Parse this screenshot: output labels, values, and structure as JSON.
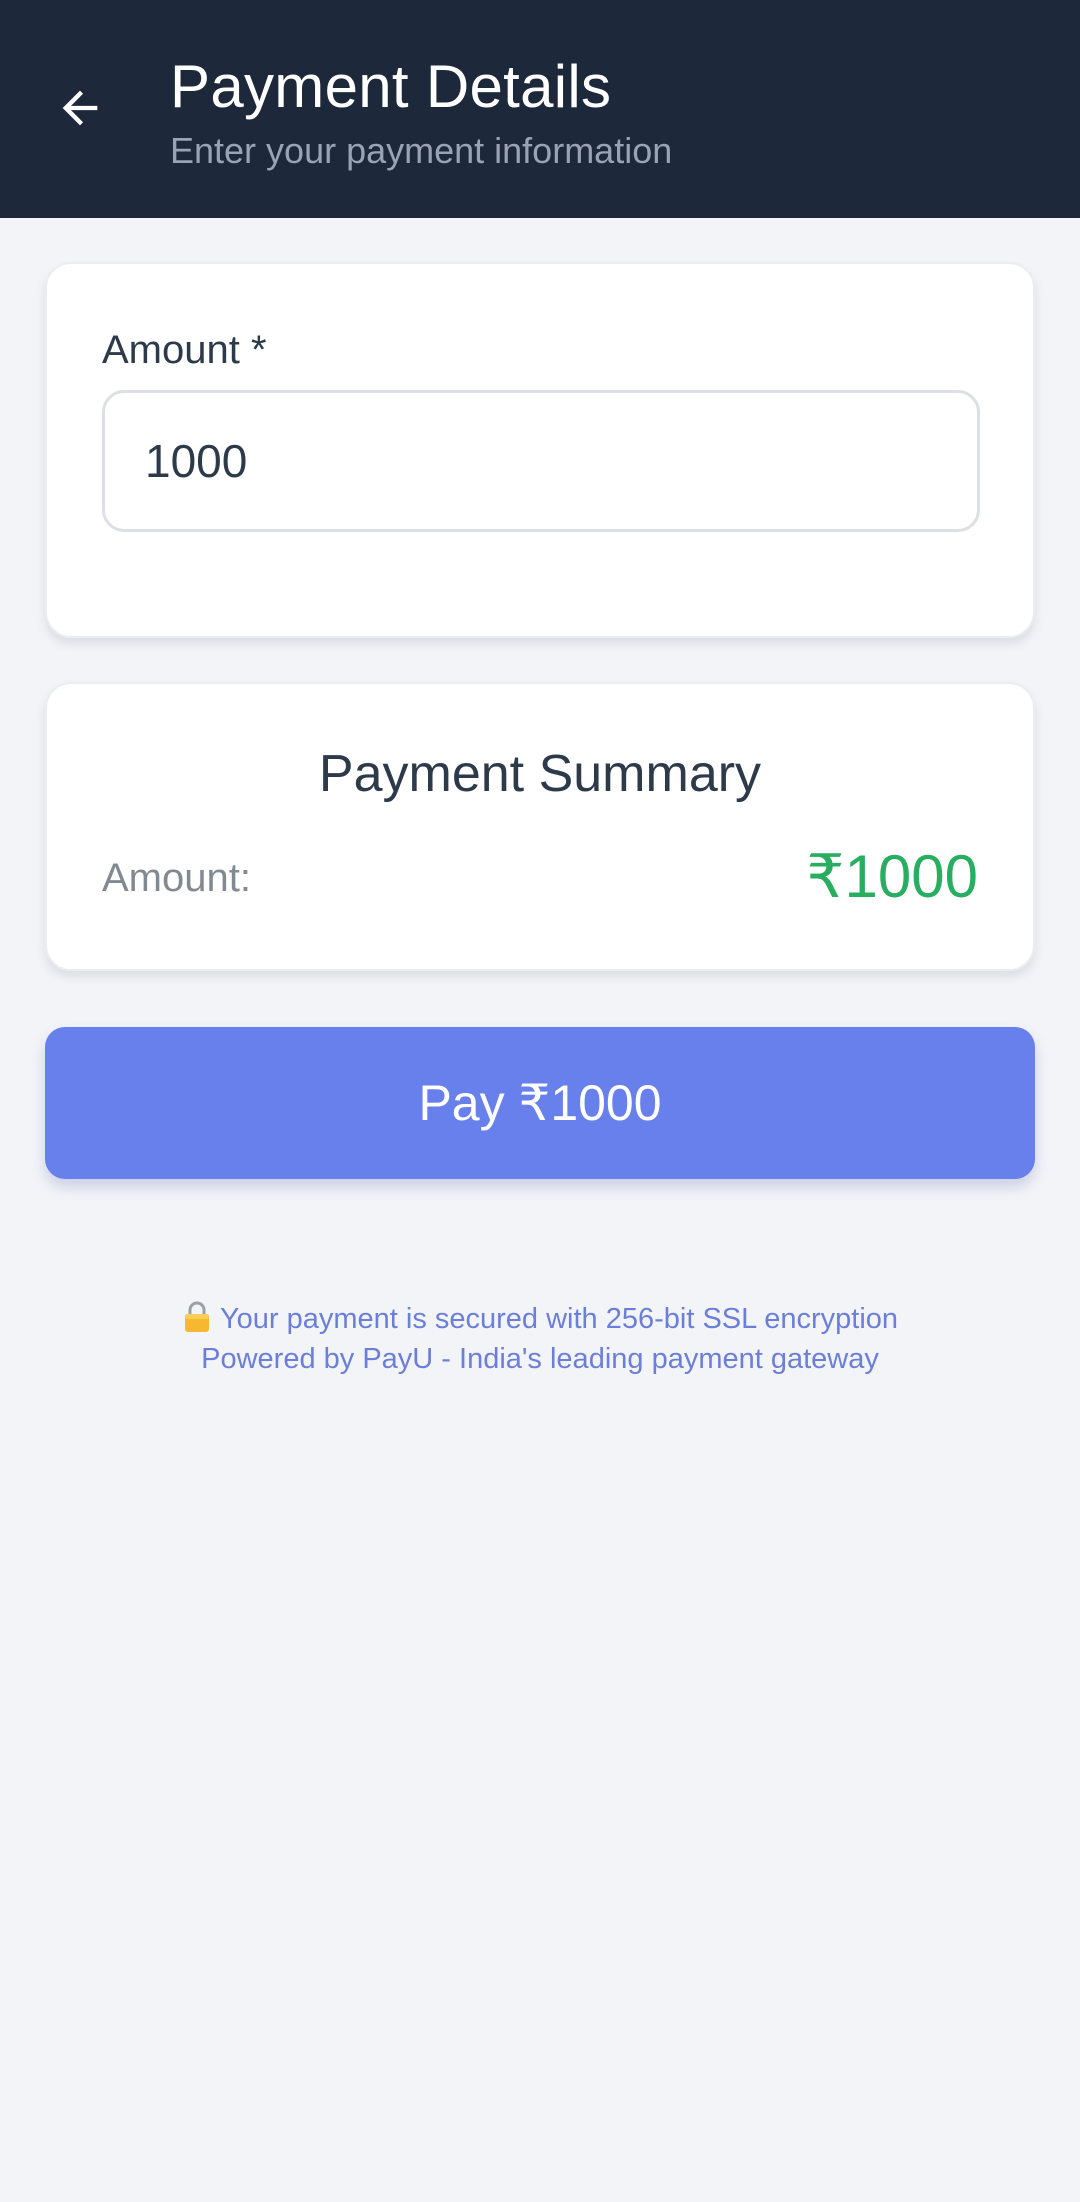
{
  "header": {
    "title": "Payment Details",
    "subtitle": "Enter your payment information",
    "back_icon": "arrow-left-icon"
  },
  "amount_card": {
    "label": "Amount *",
    "value": "1000"
  },
  "summary_card": {
    "title": "Payment Summary",
    "amount_label": "Amount:",
    "amount_value": "₹1000"
  },
  "pay_button": {
    "label": "Pay ₹1000"
  },
  "footer": {
    "lock_icon": "lock-icon",
    "security_text": "Your payment is secured with 256-bit SSL encryption",
    "powered_by": "Powered by PayU - India's leading payment gateway"
  },
  "colors": {
    "header_bg": "#1e283b",
    "page_bg": "#f3f4f8",
    "accent": "#6880eb",
    "success": "#27ae60",
    "footer_text": "#6b7fd8"
  }
}
